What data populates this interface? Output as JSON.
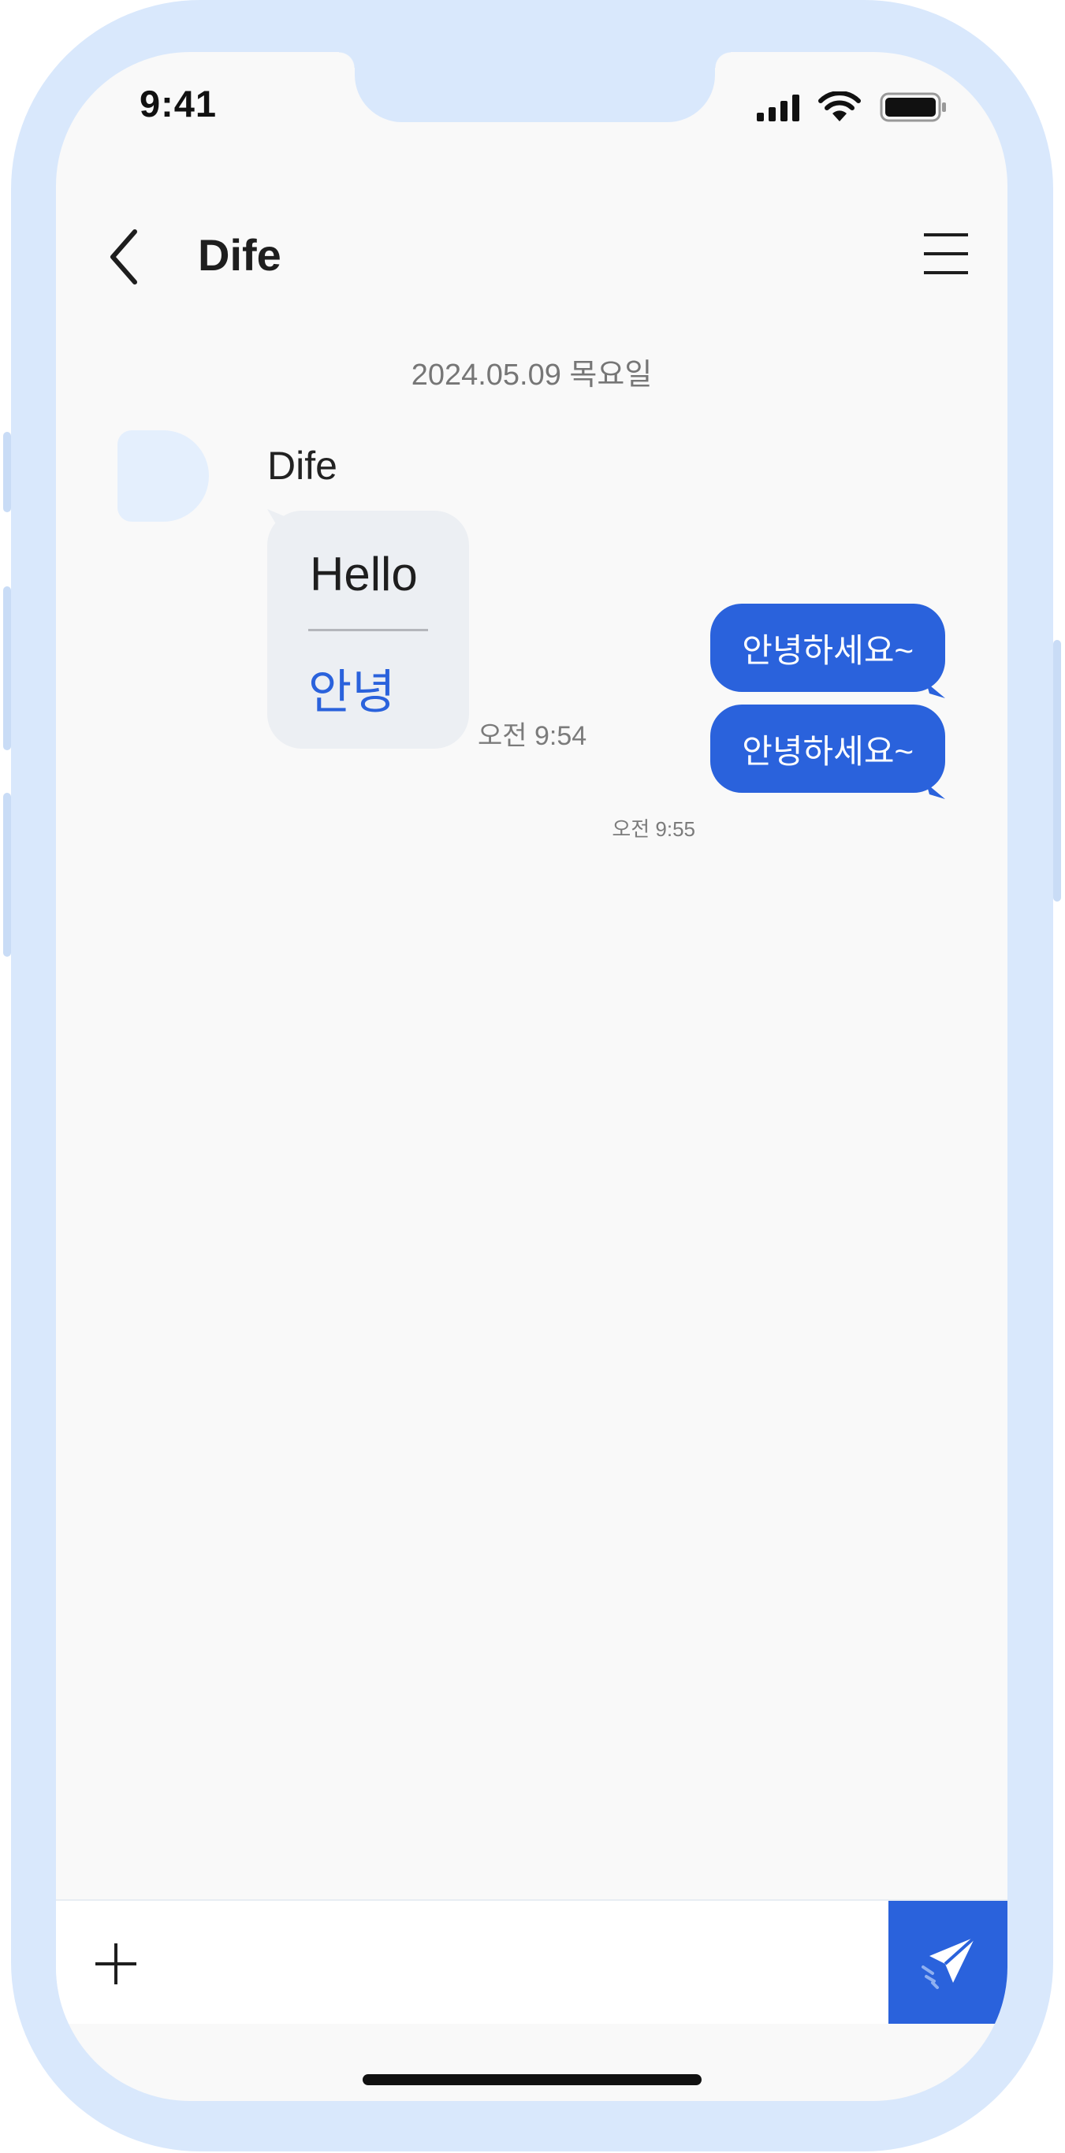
{
  "status_bar": {
    "time": "9:41"
  },
  "header": {
    "title": "Dife"
  },
  "chat": {
    "date": "2024.05.09 목요일",
    "received": {
      "sender": "Dife",
      "text_en": "Hello",
      "text_ko": "안녕",
      "time": "오전 9:54"
    },
    "sent": [
      {
        "text": "안녕하세요~"
      },
      {
        "text": "안녕하세요~",
        "time": "오전 9:55"
      }
    ]
  },
  "colors": {
    "accent": "#2a62dc",
    "frame": "#d9e8fc",
    "screen_bg": "#f9f9f9",
    "received_bubble": "#eceff3"
  },
  "icons": {
    "back": "chevron-left-icon",
    "menu": "hamburger-menu-icon",
    "add": "plus-icon",
    "send": "paper-plane-icon"
  }
}
